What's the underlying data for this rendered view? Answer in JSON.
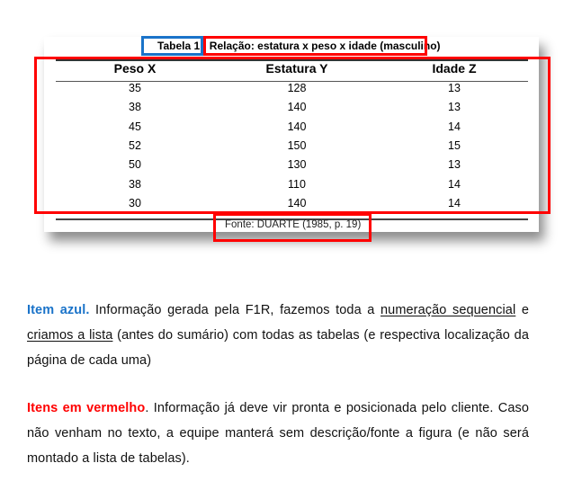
{
  "table": {
    "caption": "Tabela 1 - Relação: estatura x peso x idade (masculino)",
    "columns": [
      "Peso X",
      "Estatura Y",
      "Idade Z"
    ],
    "rows": [
      [
        "35",
        "128",
        "13"
      ],
      [
        "38",
        "140",
        "13"
      ],
      [
        "45",
        "140",
        "14"
      ],
      [
        "52",
        "150",
        "15"
      ],
      [
        "50",
        "130",
        "13"
      ],
      [
        "38",
        "110",
        "14"
      ],
      [
        "30",
        "140",
        "14"
      ]
    ],
    "source": "Fonte: DUARTE (1985, p. 19)"
  },
  "highlights": {
    "blue_color": "#1a73c9",
    "red_color": "#ff0000"
  },
  "paragraphs": {
    "p1": {
      "lead": "Item azul.",
      "t1": " Informação gerada pela F1R, fazemos toda a ",
      "u1": "numeração sequencial",
      "t2": " e ",
      "u2": "criamos a lista",
      "t3": " (antes do sumário) com todas as tabelas (e respectiva localização da página de cada uma)"
    },
    "p2": {
      "lead": "Itens em vermelho",
      "t1": ". Informação já deve vir pronta e posicionada pelo cliente. Caso não venham no texto, a equipe manterá sem descrição/fonte a figura (e não será montado a lista de tabelas)."
    }
  }
}
